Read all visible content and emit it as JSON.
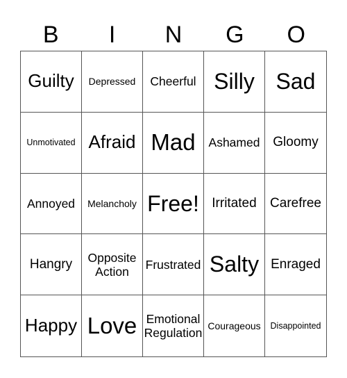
{
  "header": {
    "letters": [
      "B",
      "I",
      "N",
      "G",
      "O"
    ]
  },
  "cells": [
    {
      "text": "Guilty",
      "size": "s24"
    },
    {
      "text": "Depressed",
      "size": "s13"
    },
    {
      "text": "Cheerful",
      "size": "s16"
    },
    {
      "text": "Silly",
      "size": "s30"
    },
    {
      "text": "Sad",
      "size": "s30"
    },
    {
      "text": "Unmotivated",
      "size": "s12"
    },
    {
      "text": "Afraid",
      "size": "s24"
    },
    {
      "text": "Mad",
      "size": "s32"
    },
    {
      "text": "Ashamed",
      "size": "s16"
    },
    {
      "text": "Gloomy",
      "size": "s18"
    },
    {
      "text": "Annoyed",
      "size": "s16"
    },
    {
      "text": "Melancholy",
      "size": "s13"
    },
    {
      "text": "Free!",
      "size": "s30"
    },
    {
      "text": "Irritated",
      "size": "s18"
    },
    {
      "text": "Carefree",
      "size": "s18"
    },
    {
      "text": "Hangry",
      "size": "s18"
    },
    {
      "text": "Opposite Action",
      "size": "s16"
    },
    {
      "text": "Frustrated",
      "size": "s16"
    },
    {
      "text": "Salty",
      "size": "s30"
    },
    {
      "text": "Enraged",
      "size": "s18"
    },
    {
      "text": "Happy",
      "size": "s24"
    },
    {
      "text": "Love",
      "size": "s32"
    },
    {
      "text": "Emotional Regulation",
      "size": "s16"
    },
    {
      "text": "Courageous",
      "size": "s13"
    },
    {
      "text": "Disappointed",
      "size": "s12"
    }
  ]
}
